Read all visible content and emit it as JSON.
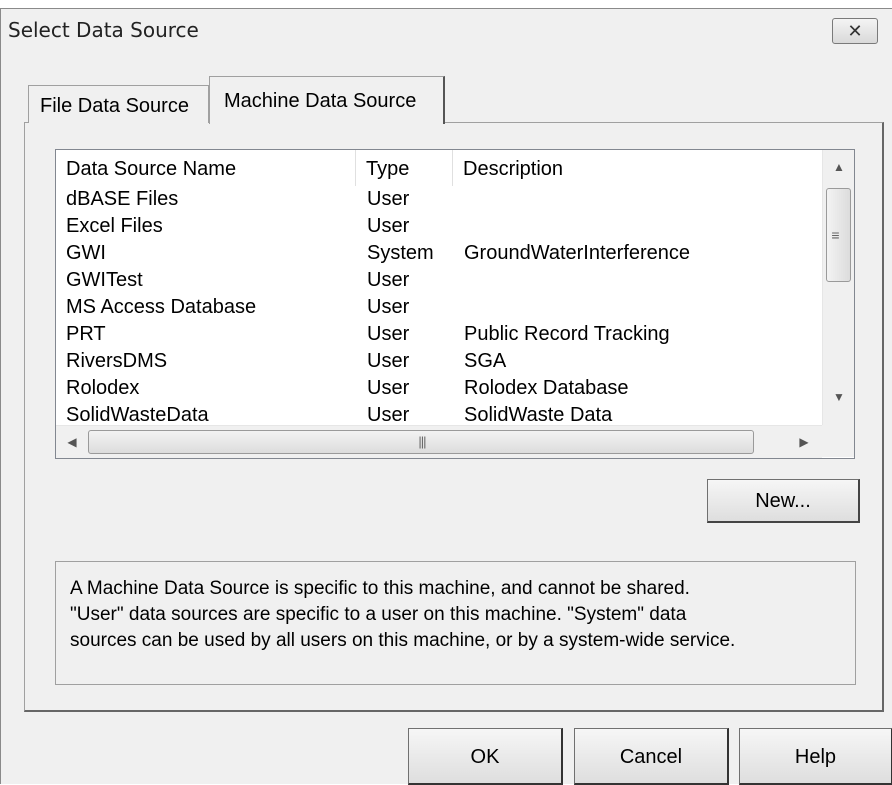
{
  "window": {
    "title": "Select Data Source",
    "close_glyph": "✕",
    "close_icon": "close-icon"
  },
  "tabs": [
    {
      "label": "File Data Source",
      "active": false
    },
    {
      "label": "Machine Data Source",
      "active": true
    }
  ],
  "list": {
    "columns": [
      "Data Source Name",
      "Type",
      "Description"
    ],
    "rows": [
      {
        "name": "dBASE Files",
        "type": "User",
        "description": ""
      },
      {
        "name": "Excel Files",
        "type": "User",
        "description": ""
      },
      {
        "name": "GWI",
        "type": "System",
        "description": "GroundWaterInterference"
      },
      {
        "name": "GWITest",
        "type": "User",
        "description": ""
      },
      {
        "name": "MS Access Database",
        "type": "User",
        "description": ""
      },
      {
        "name": "PRT",
        "type": "User",
        "description": "Public Record Tracking"
      },
      {
        "name": "RiversDMS",
        "type": "User",
        "description": "SGA"
      },
      {
        "name": "Rolodex",
        "type": "User",
        "description": "Rolodex Database"
      },
      {
        "name": "SolidWasteData",
        "type": "User",
        "description": "SolidWaste Data"
      }
    ],
    "scroll_up_icon": "scroll-up-arrow-icon",
    "scroll_down_icon": "scroll-down-arrow-icon",
    "scroll_left_icon": "scroll-left-arrow-icon",
    "scroll_right_icon": "scroll-right-arrow-icon",
    "up_glyph": "▲",
    "down_glyph": "▼",
    "left_glyph": "◀",
    "right_glyph": "▶",
    "vgrip_glyph": "≡",
    "hgrip_glyph": "|||"
  },
  "buttons": {
    "new": "New...",
    "ok": "OK",
    "cancel": "Cancel",
    "help": "Help"
  },
  "info": {
    "text": "A Machine Data Source is specific to this machine, and cannot be shared.\n\"User\" data sources are specific to a user on this machine.  \"System\" data\nsources can be used by all users on this machine, or by a system-wide service."
  },
  "colors": {
    "dialog_bg": "#f0f0f0",
    "list_bg": "#ffffff",
    "border": "#a0a0a0"
  }
}
